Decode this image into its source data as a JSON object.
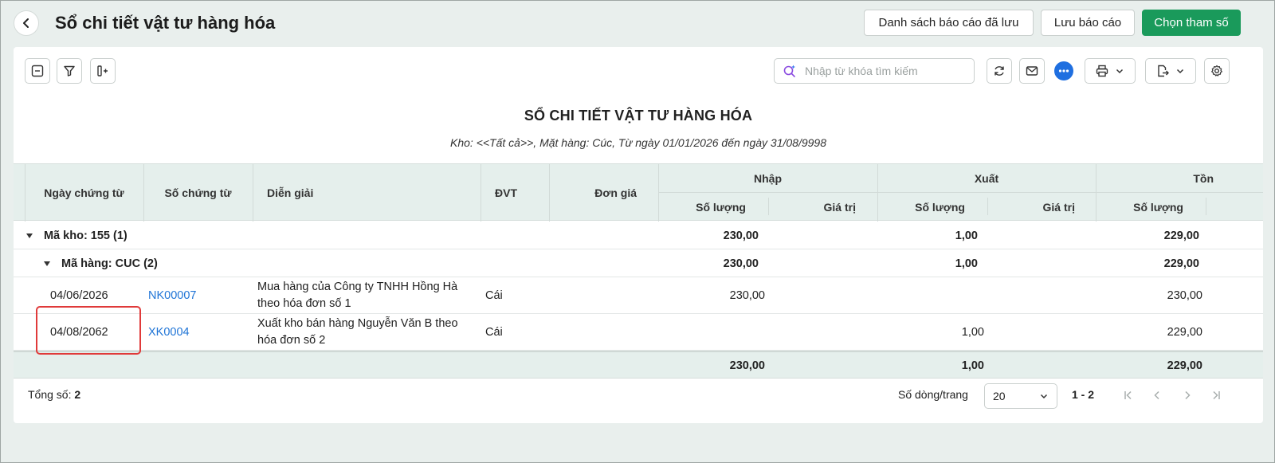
{
  "header": {
    "title": "Sổ chi tiết vật tư hàng hóa",
    "saved_reports_label": "Danh sách báo cáo đã lưu",
    "save_report_label": "Lưu báo cáo",
    "choose_params_label": "Chọn tham số"
  },
  "toolbar": {
    "search_placeholder": "Nhập từ khóa tìm kiếm",
    "accent_color": "#1a9a5b",
    "chat_color": "#1f6fe0"
  },
  "report": {
    "title": "SỔ CHI TIẾT VẬT TƯ HÀNG HÓA",
    "subtitle": "Kho: <<Tất cả>>, Mặt hàng: Cúc, Từ ngày 01/01/2026 đến ngày 31/08/9998"
  },
  "table": {
    "columns": {
      "date": "Ngày chứng từ",
      "doc_no": "Số chứng từ",
      "desc": "Diễn giải",
      "unit": "ĐVT",
      "unit_price": "Đơn giá",
      "import": "Nhập",
      "export": "Xuất",
      "stock": "Tồn",
      "qty": "Số lượng",
      "value": "Giá trị"
    },
    "group1": {
      "label": "Mã kho: 155 (1)",
      "import_qty": "230,00",
      "export_qty": "1,00",
      "stock_qty": "229,00"
    },
    "group2": {
      "label": "Mã hàng: CUC (2)",
      "import_qty": "230,00",
      "export_qty": "1,00",
      "stock_qty": "229,00"
    },
    "rows": [
      {
        "date": "04/06/2026",
        "doc_no": "NK00007",
        "desc_line1": "Mua hàng của Công ty TNHH Hồng Hà",
        "desc_line2": "theo hóa đơn số 1",
        "unit": "Cái",
        "import_qty": "230,00",
        "export_qty": "",
        "stock_qty": "230,00"
      },
      {
        "date": "04/08/2062",
        "doc_no": "XK0004",
        "desc_line1": "Xuất kho bán hàng Nguyễn Văn B theo",
        "desc_line2": "hóa đơn số 2",
        "unit": "Cái",
        "import_qty": "",
        "export_qty": "1,00",
        "stock_qty": "229,00"
      }
    ],
    "total": {
      "import_qty": "230,00",
      "export_qty": "1,00",
      "stock_qty": "229,00"
    }
  },
  "footer": {
    "total_label": "Tổng số:",
    "total_value": "2",
    "rows_per_page_label": "Số dòng/trang",
    "rows_per_page": "20",
    "range": "1 - 2"
  }
}
